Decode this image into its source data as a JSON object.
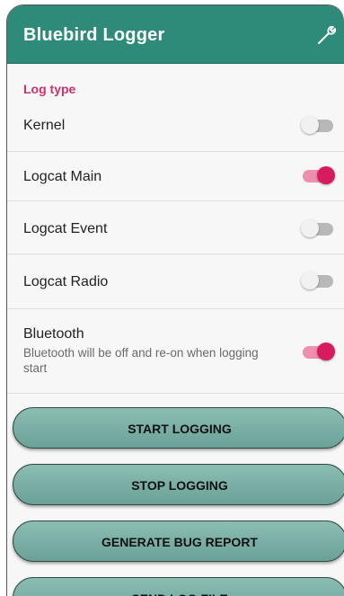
{
  "app": {
    "title": "Bluebird Logger",
    "settings_icon": "wrench-icon"
  },
  "log_type": {
    "header": "Log type",
    "items": [
      {
        "title": "Kernel",
        "summary": "",
        "enabled": false
      },
      {
        "title": "Logcat Main",
        "summary": "",
        "enabled": true
      },
      {
        "title": "Logcat Event",
        "summary": "",
        "enabled": false
      },
      {
        "title": "Logcat Radio",
        "summary": "",
        "enabled": false
      },
      {
        "title": "Bluetooth",
        "summary": "Bluetooth will be off and re-on when logging start",
        "enabled": true
      }
    ]
  },
  "actions": {
    "start": "START LOGGING",
    "stop": "STOP LOGGING",
    "bug_report": "GENERATE BUG REPORT",
    "send": "SEND LOG FILE"
  },
  "colors": {
    "app_bar": "#2e8b7a",
    "accent": "#d81b5f",
    "section_header": "#d0306a",
    "button": "#7ab0a6"
  }
}
